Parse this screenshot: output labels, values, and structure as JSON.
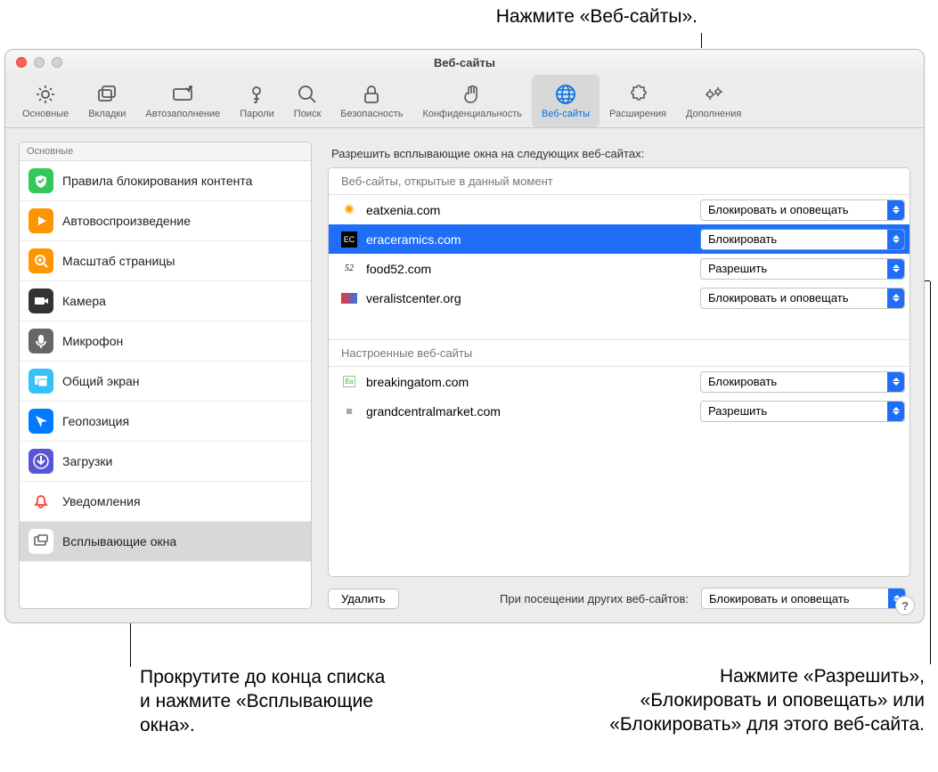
{
  "callouts": {
    "top": "Нажмите «Веб-сайты».",
    "left": "Прокрутите до конца списка и нажмите «Всплывающие окна».",
    "right": "Нажмите «Разрешить», «Блокировать и оповещать» или «Блокировать» для этого веб-сайта."
  },
  "window_title": "Веб-сайты",
  "toolbar": [
    {
      "label": "Основные",
      "icon": "gear"
    },
    {
      "label": "Вкладки",
      "icon": "tabs"
    },
    {
      "label": "Автозаполнение",
      "icon": "autofill"
    },
    {
      "label": "Пароли",
      "icon": "key"
    },
    {
      "label": "Поиск",
      "icon": "search"
    },
    {
      "label": "Безопасность",
      "icon": "lock"
    },
    {
      "label": "Конфиденциальность",
      "icon": "hand"
    },
    {
      "label": "Веб-сайты",
      "icon": "globe",
      "active": true
    },
    {
      "label": "Расширения",
      "icon": "puzzle"
    },
    {
      "label": "Дополнения",
      "icon": "gears"
    }
  ],
  "sidebar_header": "Основные",
  "sidebar": [
    {
      "label": "Правила блокирования контента",
      "icon": "shield",
      "bg": "#34c759"
    },
    {
      "label": "Автовоспроизведение",
      "icon": "play",
      "bg": "#ff9500"
    },
    {
      "label": "Масштаб страницы",
      "icon": "zoom",
      "bg": "#ff9500"
    },
    {
      "label": "Камера",
      "icon": "camera",
      "bg": "#333"
    },
    {
      "label": "Микрофон",
      "icon": "mic",
      "bg": "#666"
    },
    {
      "label": "Общий экран",
      "icon": "screen",
      "bg": "#34c2f6"
    },
    {
      "label": "Геопозиция",
      "icon": "location",
      "bg": "#007aff"
    },
    {
      "label": "Загрузки",
      "icon": "download",
      "bg": "#5856d6"
    },
    {
      "label": "Уведомления",
      "icon": "bell",
      "bg": "#ff3b30"
    },
    {
      "label": "Всплывающие окна",
      "icon": "popup",
      "bg": "#888",
      "selected": true
    }
  ],
  "pane_title": "Разрешить всплывающие окна на следующих веб-сайтах:",
  "section_open": "Веб-сайты, открытые в данный момент",
  "section_configured": "Настроенные веб-сайты",
  "open_sites": [
    {
      "domain": "eatxenia.com",
      "value": "Блокировать и оповещать",
      "fav": "sun"
    },
    {
      "domain": "eraceramics.com",
      "value": "Блокировать",
      "fav": "ec",
      "selected": true
    },
    {
      "domain": "food52.com",
      "value": "Разрешить",
      "fav": "52"
    },
    {
      "domain": "veralistcenter.org",
      "value": "Блокировать и оповещать",
      "fav": "vl"
    }
  ],
  "configured_sites": [
    {
      "domain": "breakingatom.com",
      "value": "Блокировать",
      "fav": "ba"
    },
    {
      "domain": "grandcentralmarket.com",
      "value": "Разрешить",
      "fav": "gc"
    }
  ],
  "footer": {
    "remove": "Удалить",
    "other_label": "При посещении других веб-сайтов:",
    "other_value": "Блокировать и оповещать"
  },
  "help": "?"
}
